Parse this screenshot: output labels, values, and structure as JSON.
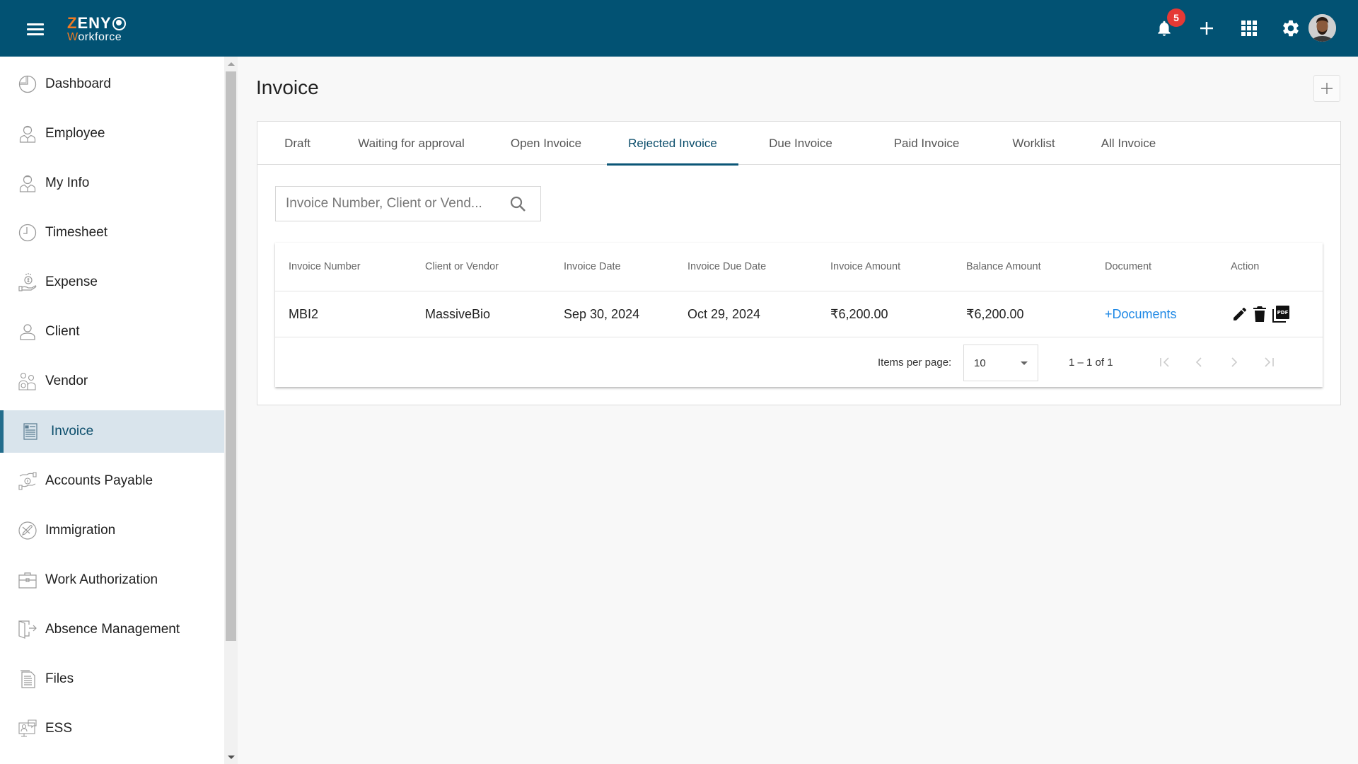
{
  "header": {
    "logo_top": "ZENY",
    "logo_bottom": "Workforce",
    "notification_count": "5",
    "icons": [
      "menu-icon",
      "bell-icon",
      "plus-icon",
      "apps-grid-icon",
      "gear-icon",
      "user-avatar"
    ]
  },
  "sidebar": {
    "active": "Invoice",
    "items": [
      {
        "label": "Dashboard",
        "icon": "dashboard-pie-icon"
      },
      {
        "label": "Employee",
        "icon": "employee-icon"
      },
      {
        "label": "My Info",
        "icon": "my-info-icon"
      },
      {
        "label": "Timesheet",
        "icon": "clock-icon"
      },
      {
        "label": "Expense",
        "icon": "expense-hand-coin-icon"
      },
      {
        "label": "Client",
        "icon": "client-person-icon"
      },
      {
        "label": "Vendor",
        "icon": "vendor-group-icon"
      },
      {
        "label": "Invoice",
        "icon": "invoice-receipt-icon"
      },
      {
        "label": "Accounts Payable",
        "icon": "accounts-payable-icon"
      },
      {
        "label": "Immigration",
        "icon": "airplane-icon"
      },
      {
        "label": "Work Authorization",
        "icon": "briefcase-icon"
      },
      {
        "label": "Absence Management",
        "icon": "exit-door-icon"
      },
      {
        "label": "Files",
        "icon": "file-icon"
      },
      {
        "label": "ESS",
        "icon": "ess-monitor-icon"
      }
    ]
  },
  "page": {
    "title": "Invoice",
    "add_button_label": "+"
  },
  "tabs": [
    {
      "label": "Draft",
      "active": false
    },
    {
      "label": "Waiting for approval",
      "active": false
    },
    {
      "label": "Open Invoice",
      "active": false
    },
    {
      "label": "Rejected Invoice",
      "active": true
    },
    {
      "label": "Due Invoice",
      "active": false
    },
    {
      "label": "Paid Invoice",
      "active": false
    },
    {
      "label": "Worklist",
      "active": false
    },
    {
      "label": "All Invoice",
      "active": false
    }
  ],
  "search": {
    "placeholder": "Invoice Number, Client or Vend...",
    "value": ""
  },
  "table": {
    "columns": [
      "Invoice Number",
      "Client or Vendor",
      "Invoice Date",
      "Invoice Due Date",
      "Invoice Amount",
      "Balance Amount",
      "Document",
      "Action"
    ],
    "rows": [
      {
        "invoice_number": "MBI2",
        "client_or_vendor": "MassiveBio",
        "invoice_date": "Sep 30, 2024",
        "invoice_due_date": "Oct 29, 2024",
        "invoice_amount": "₹6,200.00",
        "balance_amount": "₹6,200.00",
        "document": "+Documents",
        "actions": [
          "edit-pencil-icon",
          "delete-trash-icon",
          "pdf-icon"
        ]
      }
    ]
  },
  "paginator": {
    "items_per_page_label": "Items per page:",
    "items_per_page": "10",
    "range": "1 – 1 of 1"
  },
  "colors": {
    "header_bg": "#025273",
    "accent": "#0b5677",
    "active_bg": "#d9e4ec",
    "link": "#1e88e5",
    "badge": "#e53935",
    "logo_orange": "#f07a22"
  }
}
